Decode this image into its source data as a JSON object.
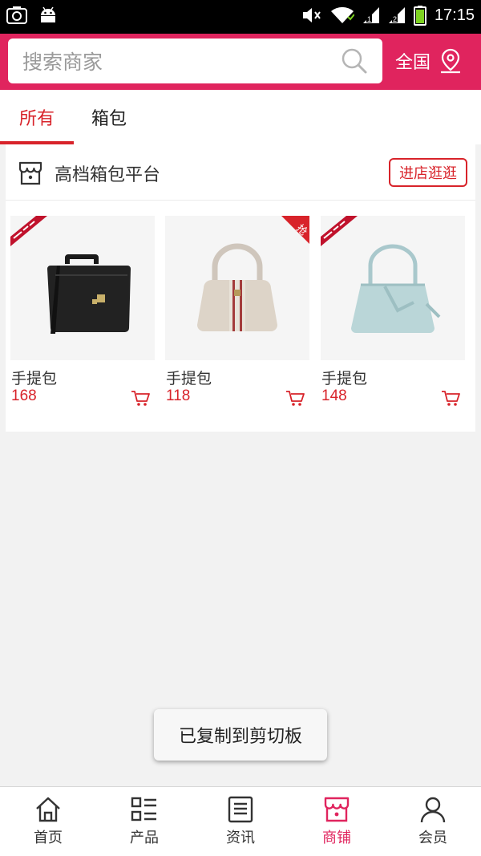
{
  "status_bar": {
    "time": "17:15"
  },
  "search": {
    "placeholder": "搜索商家"
  },
  "region": {
    "label": "全国"
  },
  "tabs": [
    {
      "label": "所有"
    },
    {
      "label": "箱包"
    }
  ],
  "shop": {
    "name": "高档箱包平台",
    "enter_label": "进店逛逛",
    "products": [
      {
        "name": "手提包",
        "price": "168",
        "badge": "ribbon-new",
        "image": "black-briefcase"
      },
      {
        "name": "手提包",
        "price": "118",
        "badge": "grab",
        "image": "beige-handbag"
      },
      {
        "name": "手提包",
        "price": "148",
        "badge": "ribbon-new",
        "image": "light-blue-tote"
      }
    ]
  },
  "toast": {
    "text": "已复制到剪切板"
  },
  "bottom_nav": [
    {
      "label": "首页",
      "icon": "home-icon"
    },
    {
      "label": "产品",
      "icon": "list-icon"
    },
    {
      "label": "资讯",
      "icon": "news-icon"
    },
    {
      "label": "商铺",
      "icon": "shop-icon",
      "active": true
    },
    {
      "label": "会员",
      "icon": "user-icon"
    }
  ],
  "colors": {
    "brand": "#e0245e",
    "price": "#d8232a"
  }
}
